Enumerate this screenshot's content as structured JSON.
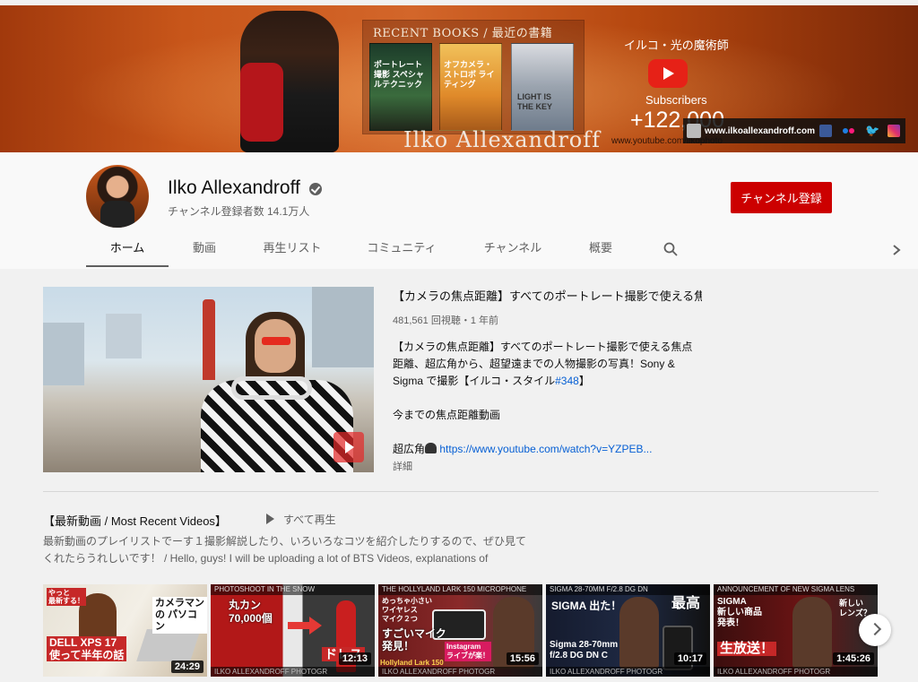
{
  "banner": {
    "books_title": "RECENT BOOKS / 最近の書籍",
    "book1_text": "ポートレート撮影 スペシャルテクニック",
    "book2_text": "オフカメラ・ストロボ ライティング",
    "book3_text": "LIGHT IS THE KEY",
    "name": "Ilko Allexandroff",
    "jp_tagline": "イルコ・光の魔術師",
    "subscribers_label": "Subscribers",
    "subscribers_count": "+122,000",
    "youtube_url": "www.youtube.com/ilkophoto",
    "website": "www.ilkoallexandroff.com"
  },
  "channel": {
    "name": "Ilko Allexandroff",
    "subscriber_count": "チャンネル登録者数 14.1万人",
    "subscribe_label": "チャンネル登録"
  },
  "tabs": [
    {
      "label": "ホーム",
      "active": true
    },
    {
      "label": "動画"
    },
    {
      "label": "再生リスト"
    },
    {
      "label": "コミュニティ"
    },
    {
      "label": "チャンネル"
    },
    {
      "label": "概要"
    }
  ],
  "featured": {
    "title": "【カメラの焦点距離】すべてのポートレート撮影で使える焦...",
    "meta": "481,561 回視聴・1 年前",
    "desc_line1": "【カメラの焦点距離】すべてのポートレート撮影で使える焦点距離、超広角から、超望遠までの人物撮影の写真！Sony & Sigma で撮影【イルコ・スタイル",
    "desc_hashtag": "#348",
    "desc_line1_end": "】",
    "desc_line2": "今までの焦点距離動画",
    "desc_line3_prefix": "超広角",
    "desc_link": "https://www.youtube.com/watch?v=YZPEB...",
    "more_label": "詳細"
  },
  "section": {
    "title": "【最新動画 / Most Recent Videos】",
    "play_all": "すべて再生",
    "description": "最新動画のプレイリストでーす１撮影解説したり、いろいろなコツを紹介したりするので、ぜひ見てくれたらうれしいです！ / Hello, guys! I will be uploading a lot of BTS Videos, explanations of"
  },
  "videos": [
    {
      "duration": "24:29",
      "label_top": "カメラマンの\nパソコン",
      "label_bottom": "DELL XPS 17\n使って半年の話",
      "corner": "やっと\n最新する！",
      "bar": ""
    },
    {
      "duration": "12:13",
      "label_top": "丸カン\n70,000個",
      "label_bottom": "ドレス",
      "corner": "",
      "bar": "PHOTOSHOOT IN THE SNOW"
    },
    {
      "duration": "15:56",
      "label_top": "めっちゃ小さい\nワイヤレス\nマイク２つ",
      "label_bottom": "すごいマイク\n発見！",
      "corner": "Instagram\nライブが楽！",
      "bar": "THE HOLLYLAND LARK 150 MICROPHONE",
      "brand": "Hollyland Lark 150"
    },
    {
      "duration": "10:17",
      "label_top": "SIGMA 出た！",
      "label_bottom": "Sigma 28-70mm\nf/2.8 DG DN C",
      "corner": "最高",
      "bar": "SIGMA 28-70MM F/2.8 DG DN"
    },
    {
      "duration": "1:45:26",
      "label_top": "SIGMA\n新しい商品\n発表！",
      "label_bottom": "生放送！",
      "corner": "新しい\nレンズ？",
      "bar": "ANNOUNCEMENT OF NEW SIGMA LENS"
    }
  ],
  "bottom_channel_label": "ILKO ALLEXANDROFF PHOTOGR",
  "colors": {
    "subscribe": "#cc0000",
    "link": "#065fd4",
    "background": "#f1f1f1",
    "header": "#f9f9f9"
  }
}
